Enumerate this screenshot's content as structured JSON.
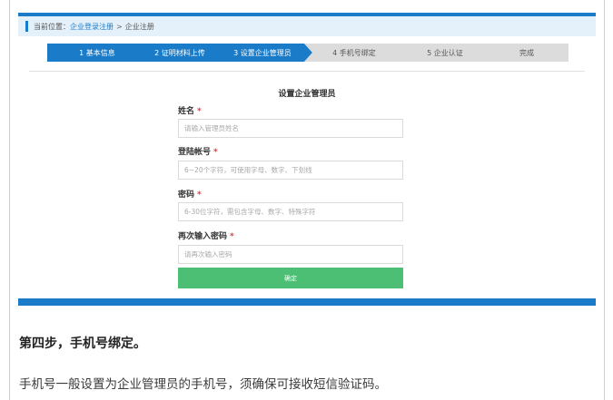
{
  "breadcrumb": {
    "prefix": "当前位置：",
    "link": "企业登录注册",
    "separator": ">",
    "current": "企业注册"
  },
  "steps": [
    {
      "label": "1 基本信息",
      "state": "done"
    },
    {
      "label": "2 证明材料上传",
      "state": "done"
    },
    {
      "label": "3 设置企业管理员",
      "state": "done"
    },
    {
      "label": "4 手机号绑定",
      "state": "pending"
    },
    {
      "label": "5 企业认证",
      "state": "pending"
    },
    {
      "label": "完成",
      "state": "pending"
    }
  ],
  "form": {
    "title": "设置企业管理员",
    "required_mark": "*",
    "fields": [
      {
        "label": "姓名",
        "placeholder": "请输入管理员姓名"
      },
      {
        "label": "登陆帐号",
        "placeholder": "6~20个字符，可使用字母、数字、下划线"
      },
      {
        "label": "密码",
        "placeholder": "6-30位字符，需包含字母、数字、特殊字符"
      },
      {
        "label": "再次输入密码",
        "placeholder": "请再次输入密码"
      }
    ],
    "submit_label": "确定"
  },
  "article": {
    "heading": "第四步，手机号绑定。",
    "body": "手机号一般设置为企业管理员的手机号，须确保可接收短信验证码。"
  },
  "colors": {
    "accent": "#1a7bc8",
    "submit": "#4cbf74",
    "required": "#e23a3a"
  }
}
